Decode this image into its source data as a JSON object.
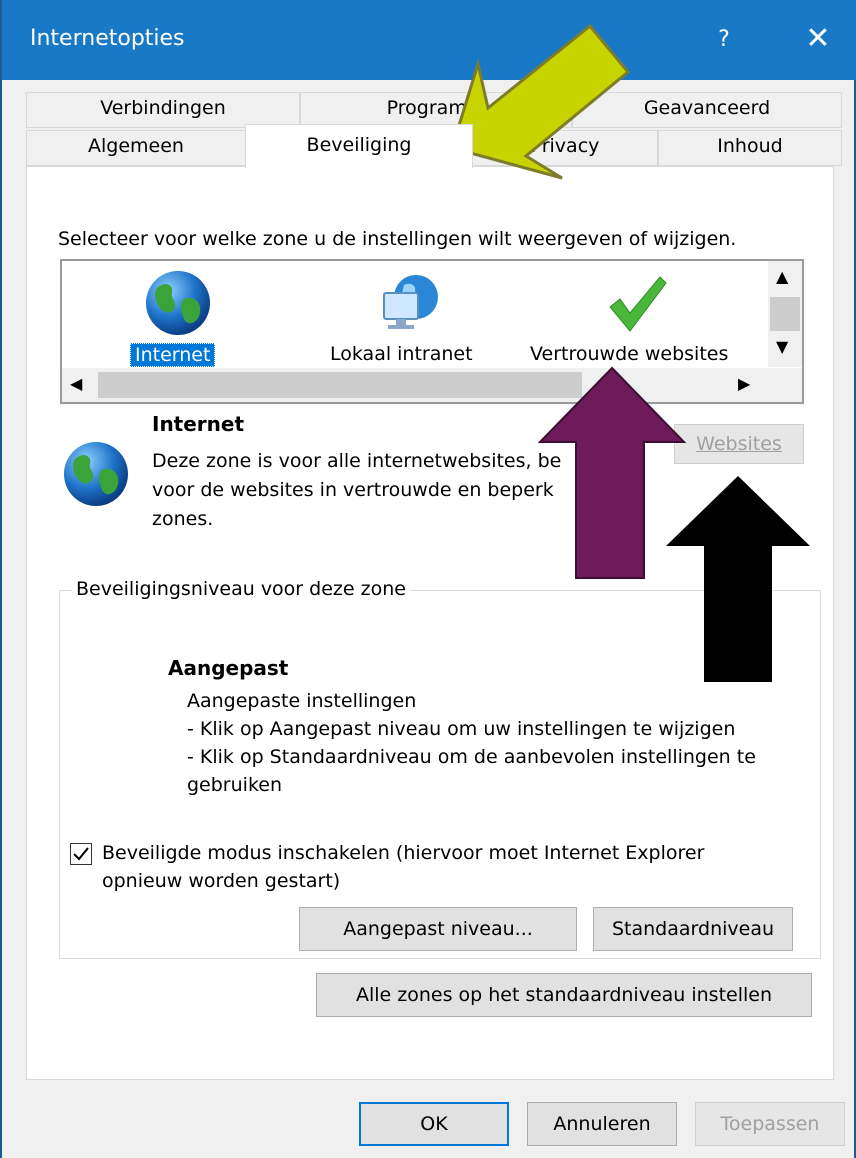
{
  "window": {
    "title": "Internetopties",
    "help": "?",
    "close": "✕"
  },
  "tabs_row1": [
    "Verbindingen",
    "Programm",
    "Geavanceerd"
  ],
  "tabs_row2": [
    "Algemeen",
    "Beveiliging",
    "Privacy",
    "Inhoud"
  ],
  "zone_prompt": "Selecteer voor welke zone u de instellingen wilt weergeven of wijzigen.",
  "zones": [
    {
      "label": "Internet",
      "icon": "globe-icon",
      "selected": true
    },
    {
      "label": "Lokaal intranet",
      "icon": "intranet-icon",
      "selected": false
    },
    {
      "label": "Vertrouwde websites",
      "icon": "checkmark-icon",
      "selected": false
    }
  ],
  "zone_info": {
    "title": "Internet",
    "line1": "Deze zone is voor alle internetwebsites, be",
    "line2": "voor de websites in vertrouwde en beperk",
    "line3": "zones.",
    "websites_button": "Websites"
  },
  "security_level": {
    "group_label": "Beveiligingsniveau voor deze zone",
    "level_name": "Aangepast",
    "line1": "Aangepaste instellingen",
    "line2": "- Klik op Aangepast niveau om uw instellingen te wijzigen",
    "line3": "- Klik op Standaardniveau om de aanbevolen instellingen te",
    "line4": "gebruiken"
  },
  "protected_mode": {
    "checked": true,
    "line1": "Beveiligde modus inschakelen (hiervoor moet Internet Explorer",
    "line2": "opnieuw worden gestart)"
  },
  "buttons": {
    "custom_level": "Aangepast niveau...",
    "default_level": "Standaardniveau",
    "reset_all": "Alle zones op het standaardniveau instellen",
    "ok": "OK",
    "cancel": "Annuleren",
    "apply": "Toepassen"
  },
  "colors": {
    "titlebar": "#1979c7",
    "arrow_yellow": "#c8d400",
    "arrow_purple": "#6e1b5c",
    "arrow_black": "#000000",
    "selection": "#0078d7"
  }
}
